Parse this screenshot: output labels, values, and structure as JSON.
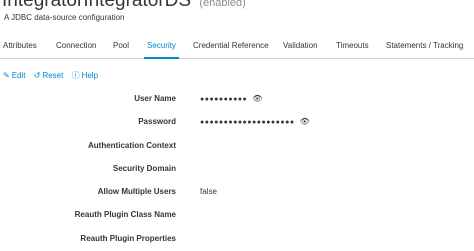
{
  "header": {
    "title": "IntegratorIntegratorDS",
    "status_badge": "(enabled)",
    "subtitle": "A JDBC data-source configuration"
  },
  "tabs": [
    {
      "label": "Attributes"
    },
    {
      "label": "Connection"
    },
    {
      "label": "Pool"
    },
    {
      "label": "Security",
      "active": true
    },
    {
      "label": "Credential Reference"
    },
    {
      "label": "Validation"
    },
    {
      "label": "Timeouts"
    },
    {
      "label": "Statements / Tracking"
    }
  ],
  "actions": {
    "edit": "Edit",
    "reset": "Reset",
    "help": "Help"
  },
  "form": {
    "fields": [
      {
        "label": "User Name",
        "value": "●●●●●●●●●●",
        "masked": true
      },
      {
        "label": "Password",
        "value": "●●●●●●●●●●●●●●●●●●●●",
        "masked": true
      },
      {
        "label": "Authentication Context",
        "value": ""
      },
      {
        "label": "Security Domain",
        "value": ""
      },
      {
        "label": "Allow Multiple Users",
        "value": "false"
      },
      {
        "label": "Reauth Plugin Class Name",
        "value": ""
      },
      {
        "label": "Reauth Plugin Properties",
        "value": ""
      }
    ]
  },
  "colors": {
    "accent": "#0088ce",
    "text": "#363636",
    "muted": "#8b8d8f"
  },
  "icons": {
    "edit": "pencil-icon",
    "reset": "undo-icon",
    "help": "question-circle-icon",
    "reveal": "eye-icon"
  }
}
